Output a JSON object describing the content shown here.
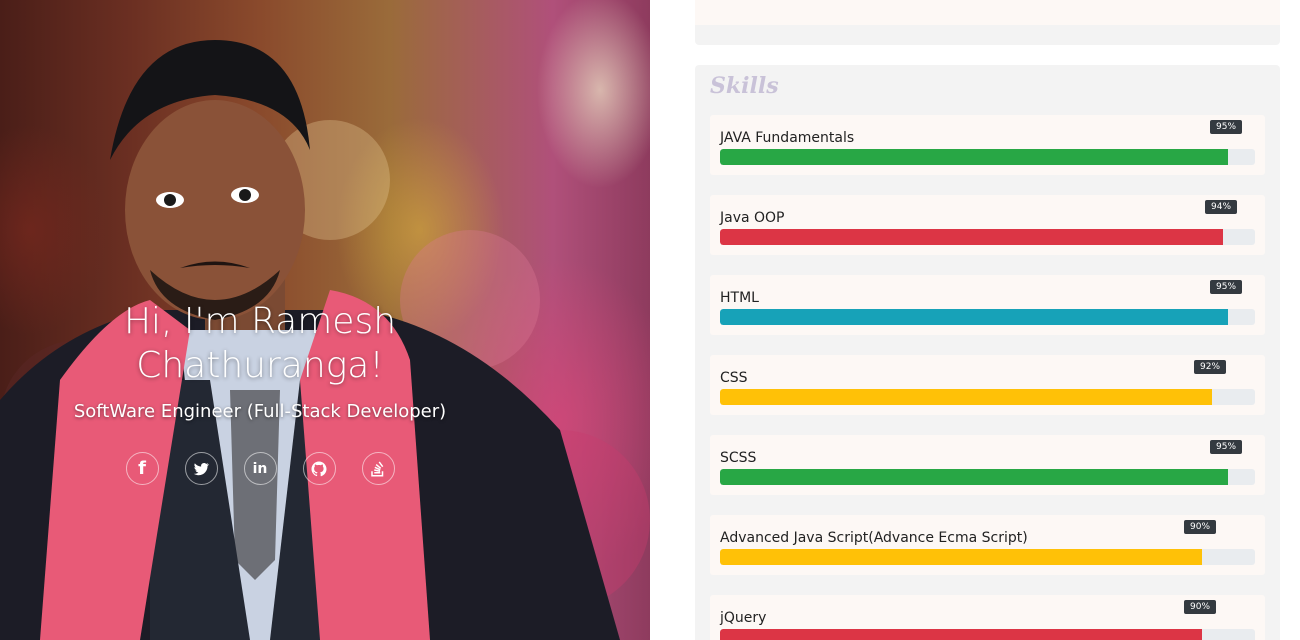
{
  "hero": {
    "title": "Hi, I'm Ramesh Chathuranga!",
    "subtitle": "SoftWare Engineer (Full-Stack Developer)",
    "social": [
      {
        "icon": "facebook-icon",
        "glyph": "f"
      },
      {
        "icon": "twitter-icon",
        "glyph": ""
      },
      {
        "icon": "linkedin-icon",
        "glyph": "in"
      },
      {
        "icon": "github-icon",
        "glyph": ""
      },
      {
        "icon": "stackoverflow-icon",
        "glyph": ""
      }
    ]
  },
  "skills": {
    "heading": "Skills",
    "items": [
      {
        "name": "JAVA Fundamentals",
        "percent": 95,
        "percent_label": "95%",
        "color": "#28a745"
      },
      {
        "name": "Java OOP",
        "percent": 94,
        "percent_label": "94%",
        "color": "#dc3545"
      },
      {
        "name": "HTML",
        "percent": 95,
        "percent_label": "95%",
        "color": "#17a2b8"
      },
      {
        "name": "CSS",
        "percent": 92,
        "percent_label": "92%",
        "color": "#ffc107"
      },
      {
        "name": "SCSS",
        "percent": 95,
        "percent_label": "95%",
        "color": "#28a745"
      },
      {
        "name": "Advanced Java Script(Advance Ecma Script)",
        "percent": 90,
        "percent_label": "90%",
        "color": "#ffc107"
      },
      {
        "name": "jQuery",
        "percent": 90,
        "percent_label": "90%",
        "color": "#dc3545"
      }
    ]
  }
}
